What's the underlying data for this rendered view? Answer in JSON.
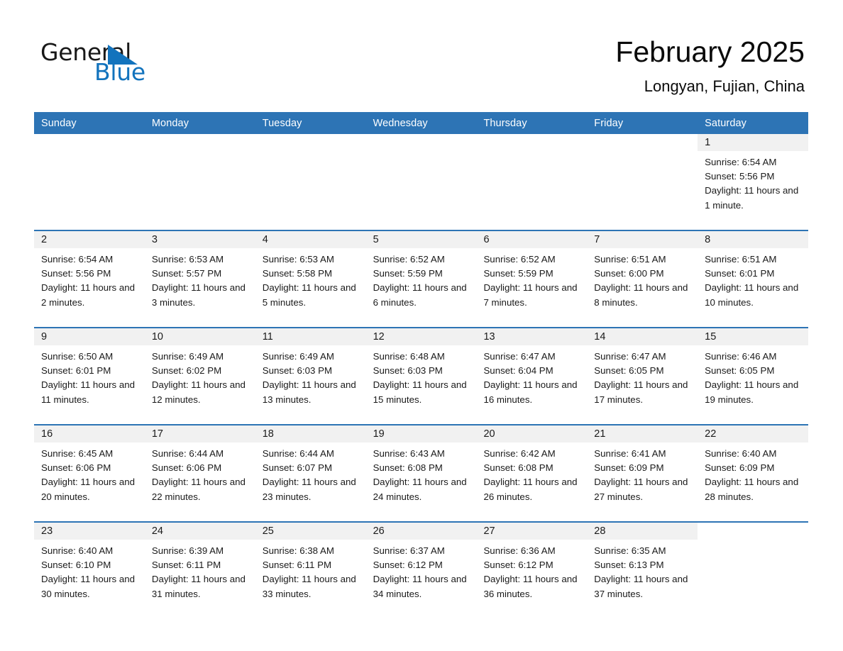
{
  "brand": {
    "word1": "General",
    "word2": "Blue",
    "accent_color": "#1273bd"
  },
  "header": {
    "title": "February 2025",
    "subtitle": "Longyan, Fujian, China"
  },
  "theme": {
    "header_blue": "#2d74b5",
    "daynum_band": "#f1f1f1",
    "text": "#1a1a1a"
  },
  "weekday_headers": [
    "Sunday",
    "Monday",
    "Tuesday",
    "Wednesday",
    "Thursday",
    "Friday",
    "Saturday"
  ],
  "weeks": [
    [
      {
        "day": ""
      },
      {
        "day": ""
      },
      {
        "day": ""
      },
      {
        "day": ""
      },
      {
        "day": ""
      },
      {
        "day": ""
      },
      {
        "day": "1",
        "sunrise": "Sunrise: 6:54 AM",
        "sunset": "Sunset: 5:56 PM",
        "daylight": "Daylight: 11 hours and 1 minute."
      }
    ],
    [
      {
        "day": "2",
        "sunrise": "Sunrise: 6:54 AM",
        "sunset": "Sunset: 5:56 PM",
        "daylight": "Daylight: 11 hours and 2 minutes."
      },
      {
        "day": "3",
        "sunrise": "Sunrise: 6:53 AM",
        "sunset": "Sunset: 5:57 PM",
        "daylight": "Daylight: 11 hours and 3 minutes."
      },
      {
        "day": "4",
        "sunrise": "Sunrise: 6:53 AM",
        "sunset": "Sunset: 5:58 PM",
        "daylight": "Daylight: 11 hours and 5 minutes."
      },
      {
        "day": "5",
        "sunrise": "Sunrise: 6:52 AM",
        "sunset": "Sunset: 5:59 PM",
        "daylight": "Daylight: 11 hours and 6 minutes."
      },
      {
        "day": "6",
        "sunrise": "Sunrise: 6:52 AM",
        "sunset": "Sunset: 5:59 PM",
        "daylight": "Daylight: 11 hours and 7 minutes."
      },
      {
        "day": "7",
        "sunrise": "Sunrise: 6:51 AM",
        "sunset": "Sunset: 6:00 PM",
        "daylight": "Daylight: 11 hours and 8 minutes."
      },
      {
        "day": "8",
        "sunrise": "Sunrise: 6:51 AM",
        "sunset": "Sunset: 6:01 PM",
        "daylight": "Daylight: 11 hours and 10 minutes."
      }
    ],
    [
      {
        "day": "9",
        "sunrise": "Sunrise: 6:50 AM",
        "sunset": "Sunset: 6:01 PM",
        "daylight": "Daylight: 11 hours and 11 minutes."
      },
      {
        "day": "10",
        "sunrise": "Sunrise: 6:49 AM",
        "sunset": "Sunset: 6:02 PM",
        "daylight": "Daylight: 11 hours and 12 minutes."
      },
      {
        "day": "11",
        "sunrise": "Sunrise: 6:49 AM",
        "sunset": "Sunset: 6:03 PM",
        "daylight": "Daylight: 11 hours and 13 minutes."
      },
      {
        "day": "12",
        "sunrise": "Sunrise: 6:48 AM",
        "sunset": "Sunset: 6:03 PM",
        "daylight": "Daylight: 11 hours and 15 minutes."
      },
      {
        "day": "13",
        "sunrise": "Sunrise: 6:47 AM",
        "sunset": "Sunset: 6:04 PM",
        "daylight": "Daylight: 11 hours and 16 minutes."
      },
      {
        "day": "14",
        "sunrise": "Sunrise: 6:47 AM",
        "sunset": "Sunset: 6:05 PM",
        "daylight": "Daylight: 11 hours and 17 minutes."
      },
      {
        "day": "15",
        "sunrise": "Sunrise: 6:46 AM",
        "sunset": "Sunset: 6:05 PM",
        "daylight": "Daylight: 11 hours and 19 minutes."
      }
    ],
    [
      {
        "day": "16",
        "sunrise": "Sunrise: 6:45 AM",
        "sunset": "Sunset: 6:06 PM",
        "daylight": "Daylight: 11 hours and 20 minutes."
      },
      {
        "day": "17",
        "sunrise": "Sunrise: 6:44 AM",
        "sunset": "Sunset: 6:06 PM",
        "daylight": "Daylight: 11 hours and 22 minutes."
      },
      {
        "day": "18",
        "sunrise": "Sunrise: 6:44 AM",
        "sunset": "Sunset: 6:07 PM",
        "daylight": "Daylight: 11 hours and 23 minutes."
      },
      {
        "day": "19",
        "sunrise": "Sunrise: 6:43 AM",
        "sunset": "Sunset: 6:08 PM",
        "daylight": "Daylight: 11 hours and 24 minutes."
      },
      {
        "day": "20",
        "sunrise": "Sunrise: 6:42 AM",
        "sunset": "Sunset: 6:08 PM",
        "daylight": "Daylight: 11 hours and 26 minutes."
      },
      {
        "day": "21",
        "sunrise": "Sunrise: 6:41 AM",
        "sunset": "Sunset: 6:09 PM",
        "daylight": "Daylight: 11 hours and 27 minutes."
      },
      {
        "day": "22",
        "sunrise": "Sunrise: 6:40 AM",
        "sunset": "Sunset: 6:09 PM",
        "daylight": "Daylight: 11 hours and 28 minutes."
      }
    ],
    [
      {
        "day": "23",
        "sunrise": "Sunrise: 6:40 AM",
        "sunset": "Sunset: 6:10 PM",
        "daylight": "Daylight: 11 hours and 30 minutes."
      },
      {
        "day": "24",
        "sunrise": "Sunrise: 6:39 AM",
        "sunset": "Sunset: 6:11 PM",
        "daylight": "Daylight: 11 hours and 31 minutes."
      },
      {
        "day": "25",
        "sunrise": "Sunrise: 6:38 AM",
        "sunset": "Sunset: 6:11 PM",
        "daylight": "Daylight: 11 hours and 33 minutes."
      },
      {
        "day": "26",
        "sunrise": "Sunrise: 6:37 AM",
        "sunset": "Sunset: 6:12 PM",
        "daylight": "Daylight: 11 hours and 34 minutes."
      },
      {
        "day": "27",
        "sunrise": "Sunrise: 6:36 AM",
        "sunset": "Sunset: 6:12 PM",
        "daylight": "Daylight: 11 hours and 36 minutes."
      },
      {
        "day": "28",
        "sunrise": "Sunrise: 6:35 AM",
        "sunset": "Sunset: 6:13 PM",
        "daylight": "Daylight: 11 hours and 37 minutes."
      },
      {
        "day": ""
      }
    ]
  ]
}
